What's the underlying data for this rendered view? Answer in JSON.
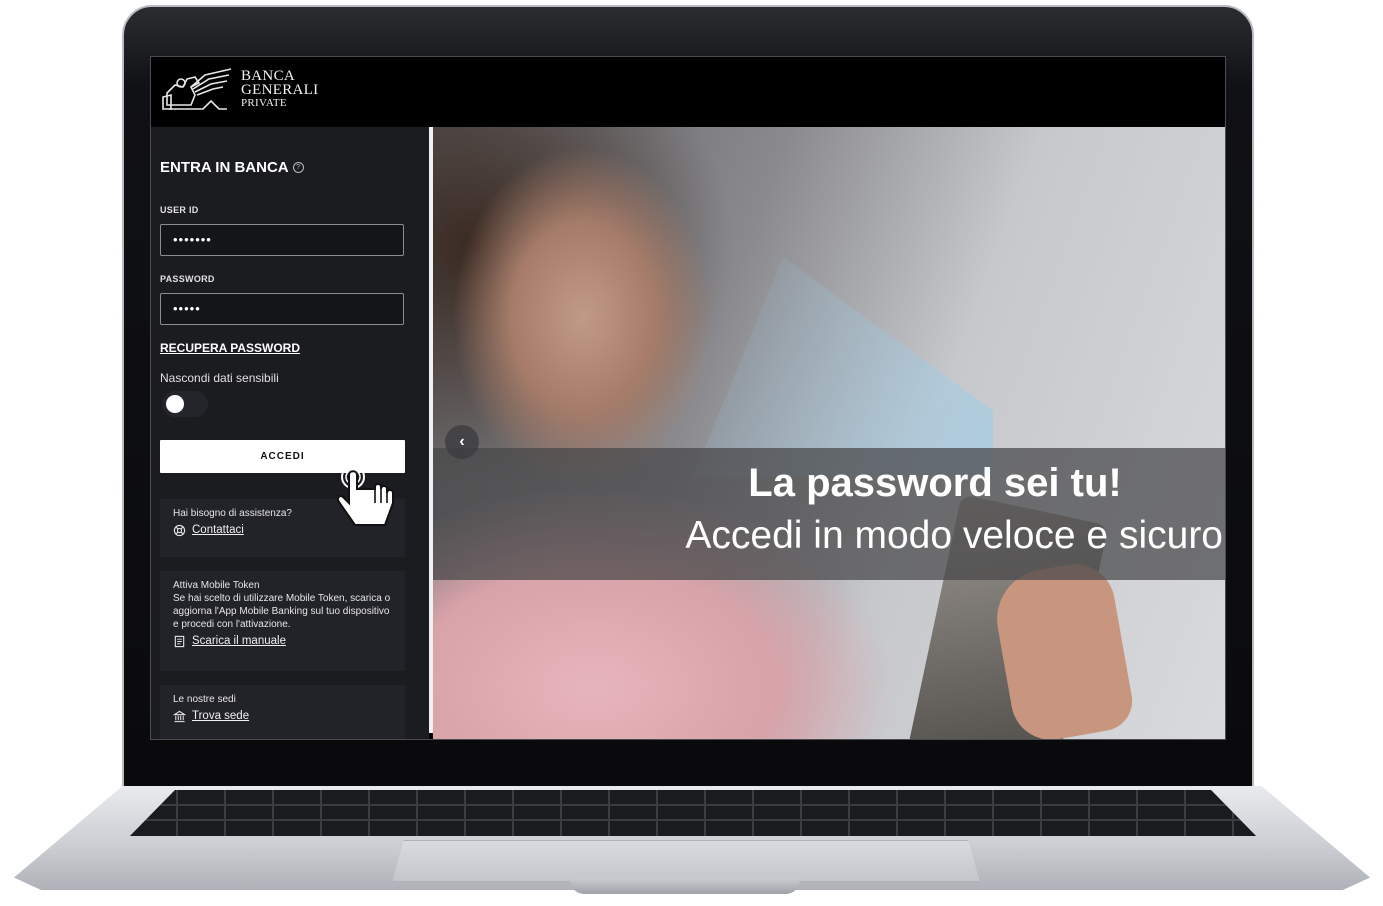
{
  "brand": {
    "line1": "BANCA",
    "line2": "GENERALI",
    "line3": "PRIVATE"
  },
  "login": {
    "title": "ENTRA IN BANCA",
    "user_label": "USER ID",
    "user_value": "•••••••",
    "password_label": "PASSWORD",
    "password_value": "•••••",
    "recover_link": "RECUPERA PASSWORD",
    "hide_label": "Nascondi dati sensibili",
    "hide_toggle_on": false,
    "submit_label": "ACCEDI"
  },
  "help_box": {
    "text": "Hai bisogno di assistenza?",
    "link": "Contattaci",
    "icon": "support-icon"
  },
  "token_box": {
    "title": "Attiva Mobile Token",
    "text": "Se hai scelto di utilizzare Mobile Token, scarica o aggiorna l'App Mobile Banking sul tuo dispositivo e procedi con l'attivazione.",
    "link": "Scarica il manuale",
    "icon": "document-icon"
  },
  "branches_box": {
    "title": "Le nostre sedi",
    "link": "Trova sede",
    "icon": "bank-icon"
  },
  "hero": {
    "title": "La password sei tu!",
    "subtitle": "Accedi in modo veloce e sicuro",
    "prev_icon": "chevron-left-icon"
  },
  "colors": {
    "panel_bg": "#1b1c20",
    "topbar_bg": "#000000",
    "button_bg": "#ffffff"
  }
}
